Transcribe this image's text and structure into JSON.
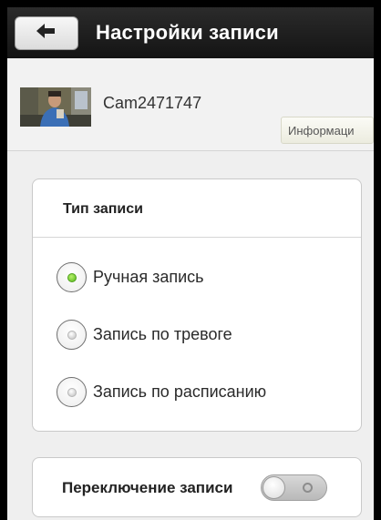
{
  "header": {
    "title": "Настройки записи",
    "back_icon": "arrow-back-icon"
  },
  "camera": {
    "name": "Cam2471747",
    "info_button": "Информаци"
  },
  "record_type": {
    "title": "Тип записи",
    "options": [
      {
        "label": "Ручная запись",
        "checked": true
      },
      {
        "label": "Запись по тревоге",
        "checked": false
      },
      {
        "label": "Запись по расписанию",
        "checked": false
      }
    ]
  },
  "record_switch": {
    "label": "Переключение записи",
    "on": false
  },
  "colors": {
    "titlebar": "#1c1c1c",
    "accent_green": "#55b81c",
    "background": "#efefef"
  }
}
